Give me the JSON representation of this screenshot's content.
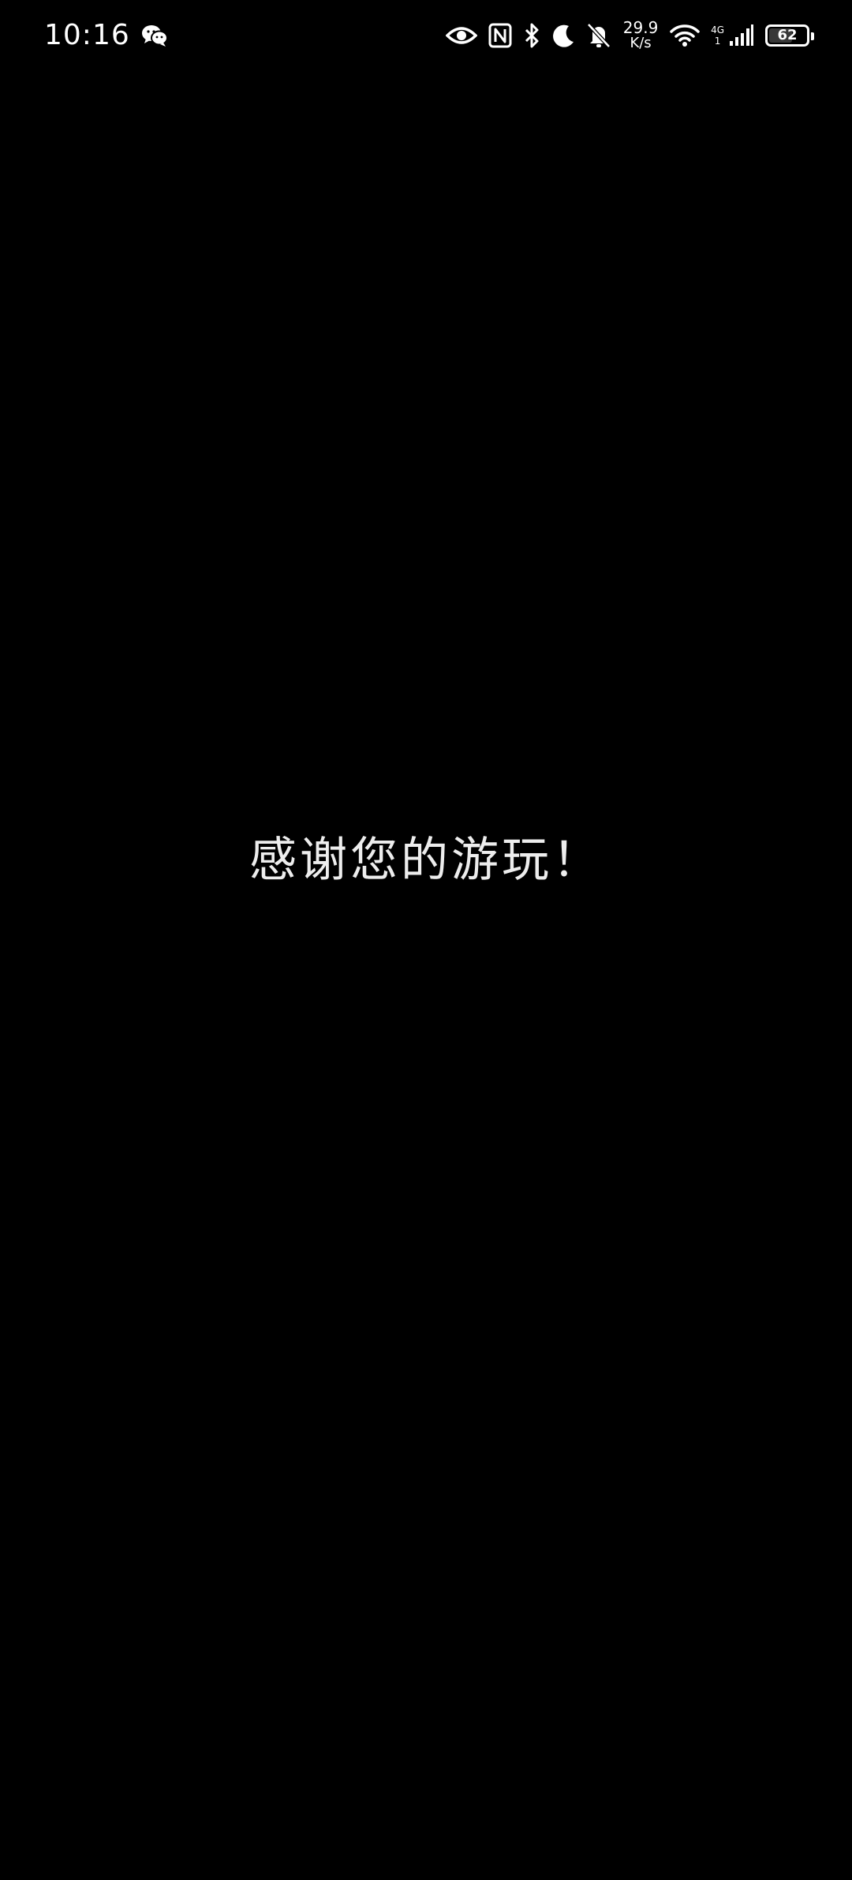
{
  "status_bar": {
    "time": "10:16",
    "net_speed_value": "29.9",
    "net_speed_unit": "K/s",
    "network_type": "4G",
    "network_sub": "1",
    "battery_level": "62",
    "battery_percent": 62,
    "icons": [
      "wechat-icon",
      "eye-icon",
      "nfc-icon",
      "bluetooth-icon",
      "moon-icon",
      "bell-off-icon",
      "wifi-icon",
      "cellular-signal-icon",
      "battery-icon"
    ]
  },
  "main": {
    "message": "感谢您的游玩！"
  },
  "colors": {
    "background": "#000000",
    "text": "#ffffff"
  }
}
